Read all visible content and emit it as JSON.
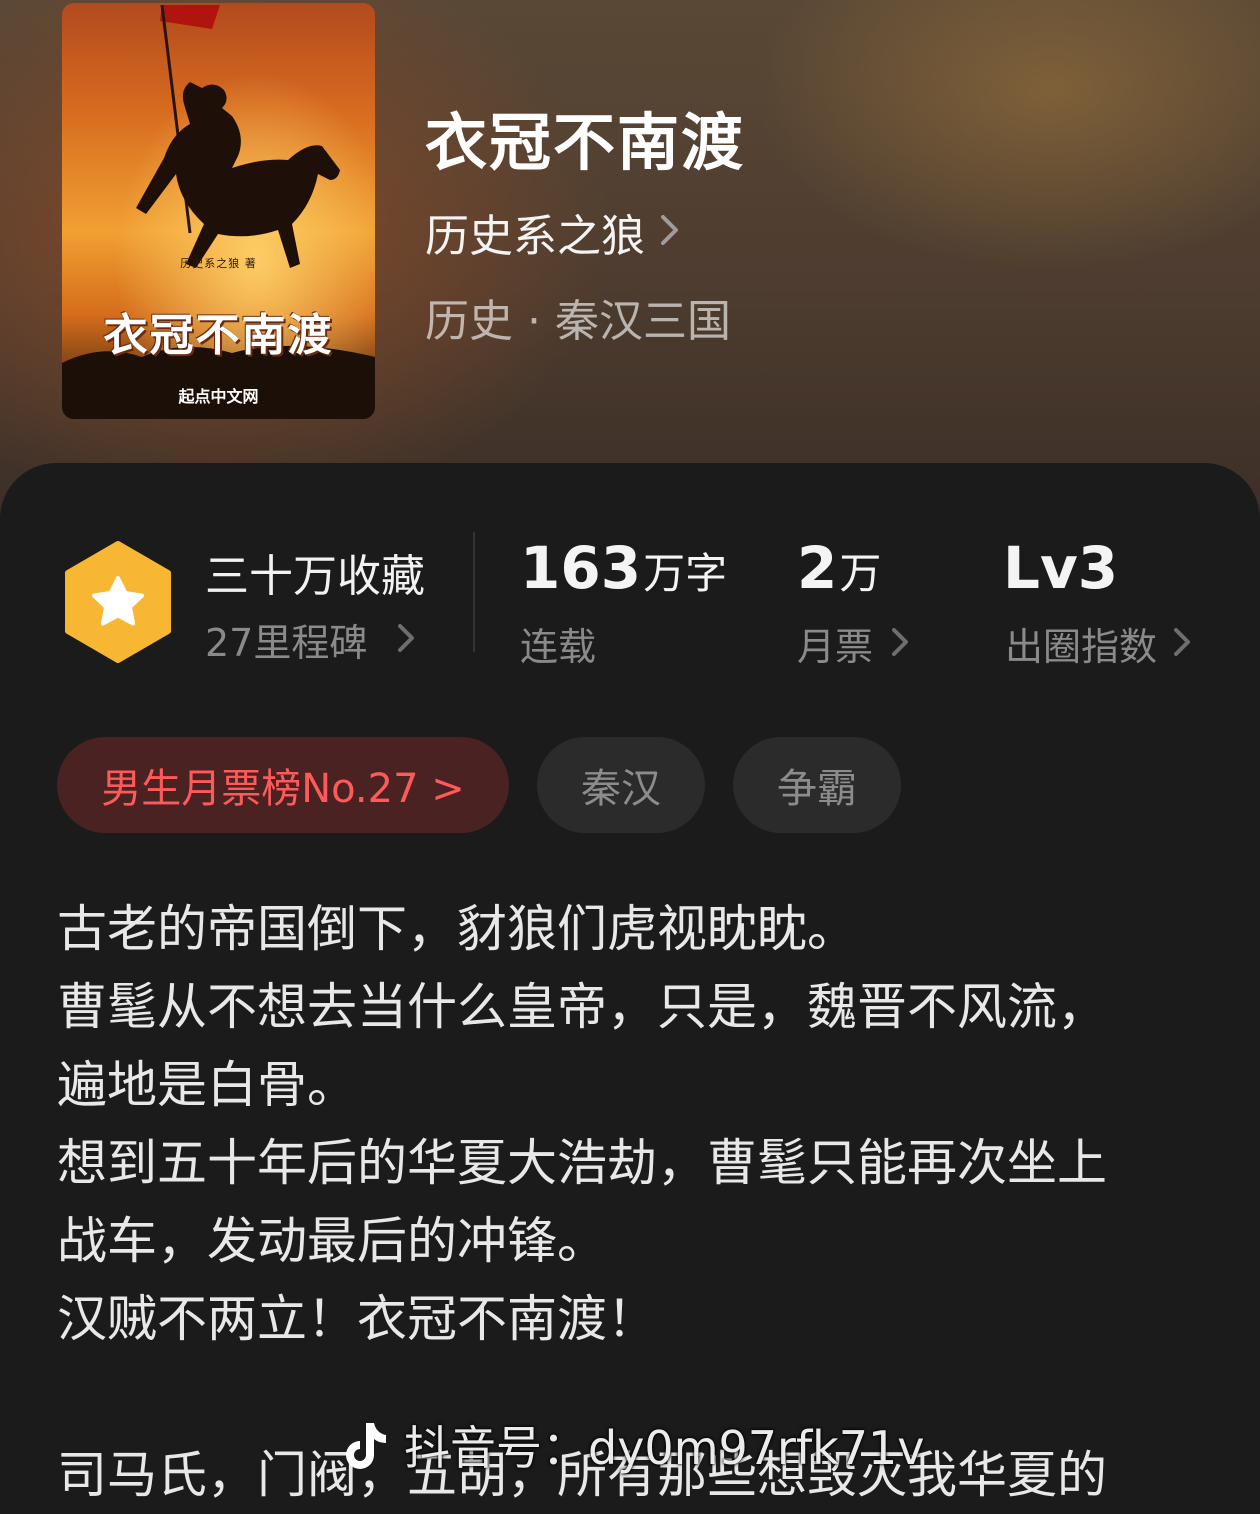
{
  "book": {
    "title": "衣冠不南渡",
    "author": "历史系之狼",
    "category": "历史 · 秦汉三国",
    "cover": {
      "author_line": "历史系之狼 著",
      "title": "衣冠不南渡",
      "publisher": "起点中文网"
    }
  },
  "stats": {
    "favorites": "三十万收藏",
    "milestones": "27里程碑",
    "word_count_value": "163",
    "word_count_unit": "万字",
    "status": "连载",
    "monthly_votes_value": "2",
    "monthly_votes_unit": "万",
    "monthly_votes_label": "月票",
    "level_value": "Lv3",
    "level_label": "出圈指数"
  },
  "tags": {
    "rank": "男生月票榜No.27 >",
    "tag1": "秦汉",
    "tag2": "争霸"
  },
  "description": {
    "lines": [
      "古老的帝国倒下，豺狼们虎视眈眈。",
      "曹髦从不想去当什么皇帝，只是，魏晋不风流，",
      "遍地是白骨。",
      "想到五十年后的华夏大浩劫，曹髦只能再次坐上",
      "战车，发动最后的冲锋。",
      "汉贼不两立！衣冠不南渡！",
      "司马氏，门阀，五胡，所有那些想毁灭我华夏的"
    ]
  },
  "watermark": {
    "text": "抖音号：dy0m97rfk71v"
  },
  "colors": {
    "rank_tag_text": "#ff5a5a",
    "rank_tag_bg": "#4a2222",
    "badge": "#f7b733",
    "card_bg": "#1b1b1b"
  },
  "icons": [
    "star-hexagon-badge-icon",
    "chevron-right-icon",
    "douyin-logo-icon"
  ]
}
